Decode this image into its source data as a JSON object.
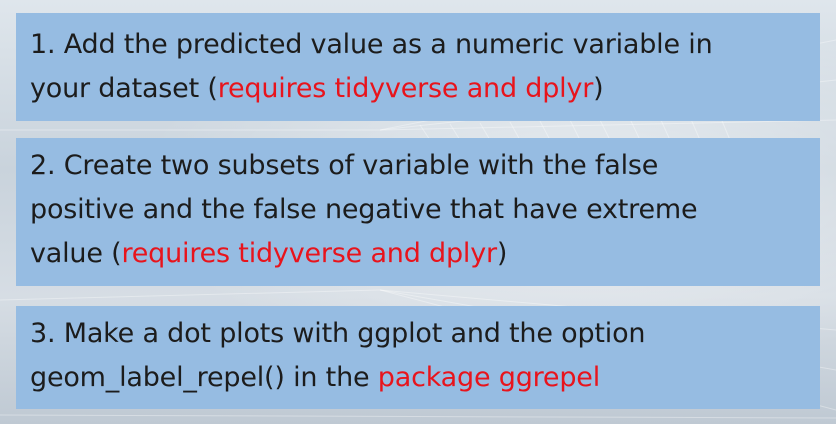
{
  "steps": [
    {
      "line1": "1. Add the predicted value as a numeric variable in",
      "line2_pre": "your dataset  (",
      "line2_red": "requires tidyverse and dplyr",
      "line2_post": ")"
    },
    {
      "line1": "2. Create two subsets of variable with the false",
      "line2": "positive and the false negative that have extreme",
      "line3_pre": "value (",
      "line3_red": "requires tidyverse and dplyr",
      "line3_post": ")"
    },
    {
      "line1": "3. Make a dot plots with ggplot and the option",
      "line2_pre": "geom_label_repel() in the ",
      "line2_red": "package ggrepel"
    }
  ],
  "colors": {
    "box": "#96bce2",
    "text": "#1c1c1c",
    "highlight": "#e8141c"
  }
}
